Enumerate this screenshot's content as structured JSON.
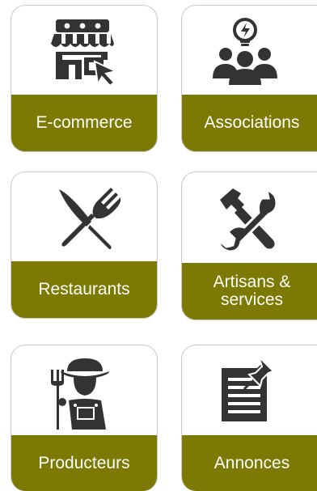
{
  "colors": {
    "band": "#7c7a03",
    "icon": "#333333",
    "label_text": "#ffffff",
    "card_border": "#c8c8c8"
  },
  "cards": [
    {
      "label": "E-commerce",
      "icon": "storefront-cursor-icon"
    },
    {
      "label": "Associations",
      "icon": "people-lightbulb-icon"
    },
    {
      "label": "Restaurants",
      "icon": "knife-fork-icon"
    },
    {
      "label_line1": "Artisans &",
      "label_line2": "services",
      "icon": "wrench-hammer-icon"
    },
    {
      "label": "Producteurs",
      "icon": "farmer-pitchfork-icon"
    },
    {
      "label": "Annonces",
      "icon": "pinned-note-icon"
    }
  ]
}
